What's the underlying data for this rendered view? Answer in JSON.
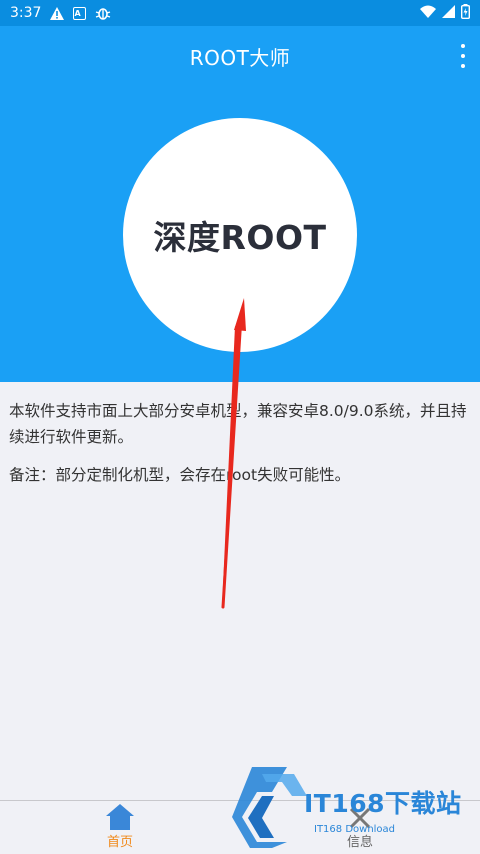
{
  "status_bar": {
    "time": "3:37",
    "icons_left": [
      "warning-icon",
      "a-box-icon",
      "bug-icon"
    ],
    "icons_right": [
      "wifi-icon",
      "signal-icon",
      "battery-icon"
    ]
  },
  "app_bar": {
    "title": "ROOT大师",
    "menu_icon": "more-vert-icon"
  },
  "hero": {
    "button_label": "深度ROOT"
  },
  "content": {
    "description": "本软件支持市面上大部分安卓机型，兼容安卓8.0/9.0系统，并且持续进行软件更新。",
    "note": "备注：部分定制化机型，会存在root失败可能性。"
  },
  "bottom_nav": {
    "items": [
      {
        "label": "首页",
        "icon": "home-icon",
        "active": true
      },
      {
        "label": "信息",
        "icon": "tools-icon",
        "active": false
      }
    ]
  },
  "watermark": {
    "brand": "IT168下载站",
    "sub": "IT168 Download"
  },
  "colors": {
    "primary": "#1aa0f5",
    "status_bar": "#0a8de0",
    "active_nav": "#f08a1c",
    "annotation_arrow": "#e8281e"
  }
}
